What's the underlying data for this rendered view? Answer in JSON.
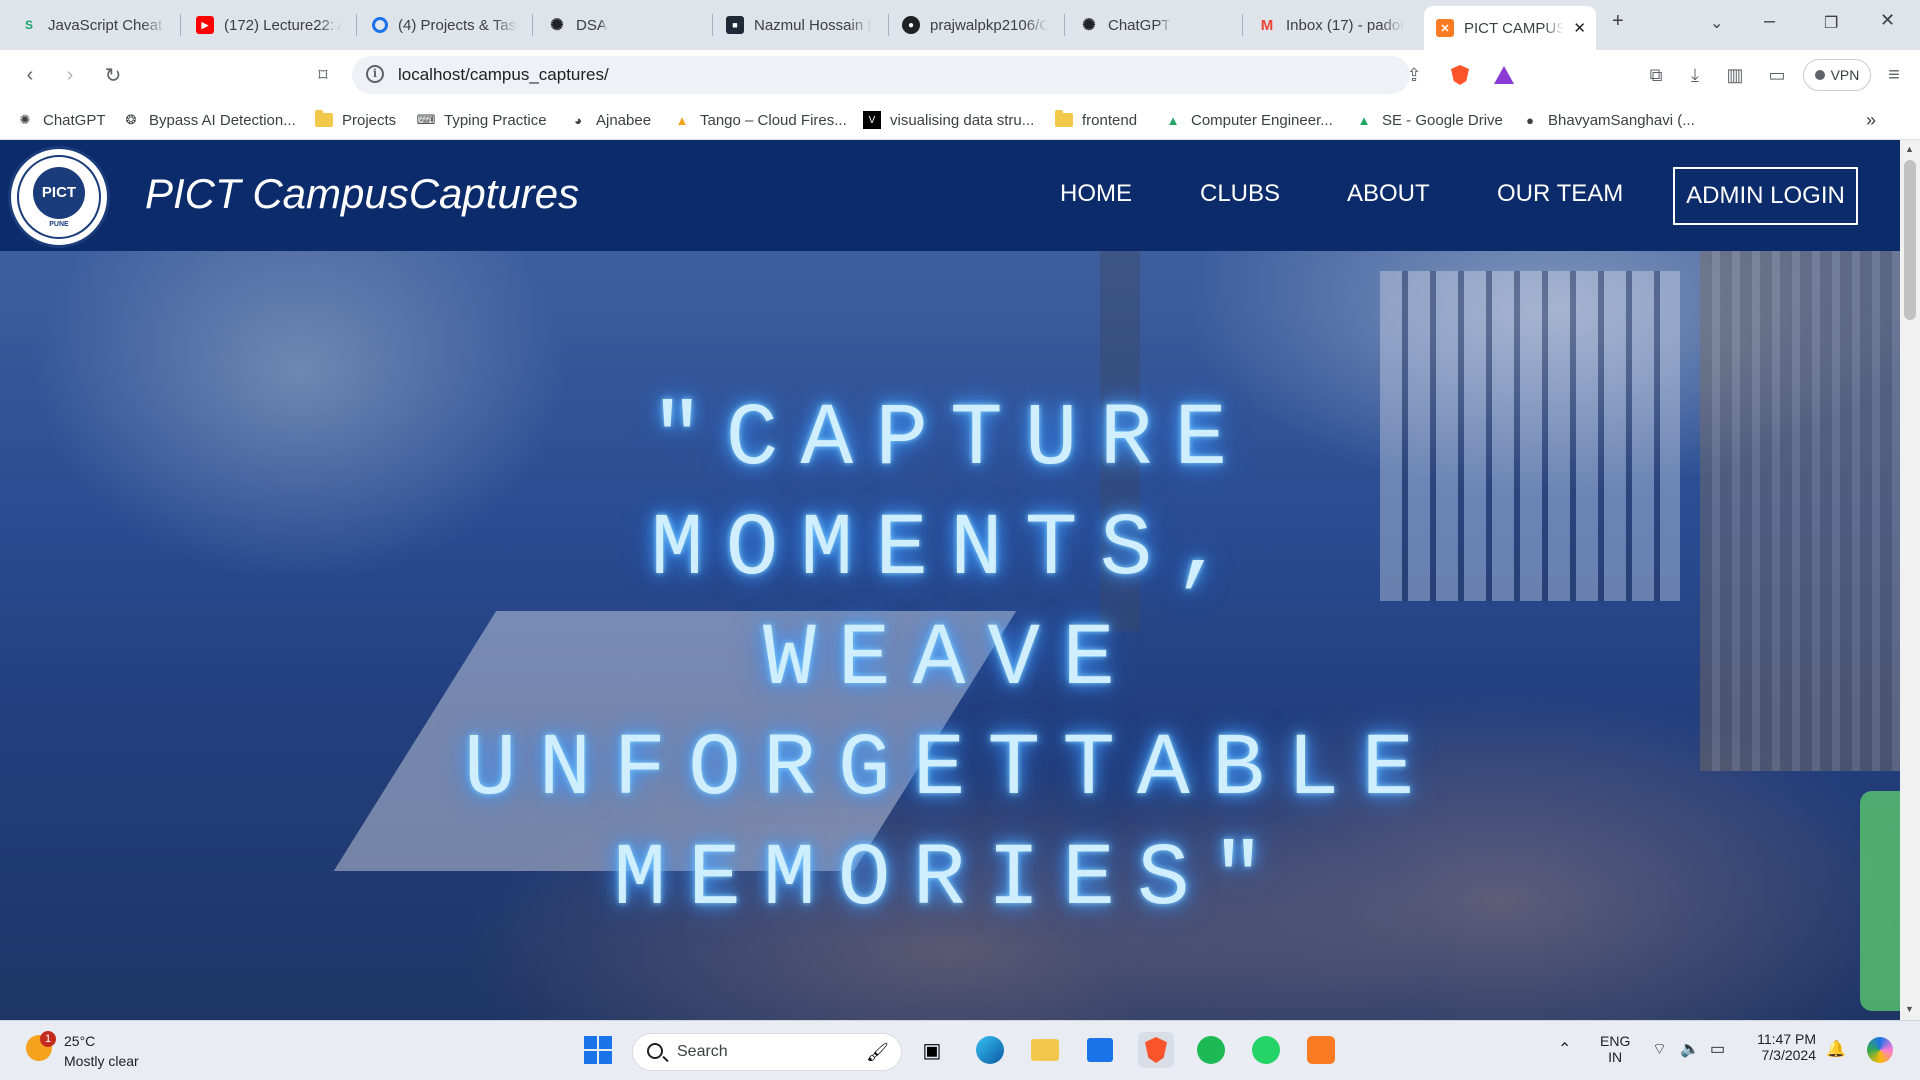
{
  "browser": {
    "tabs": [
      {
        "title": "JavaScript Cheat S",
        "icon": "javascript-cheatsheet-icon"
      },
      {
        "title": "(172) Lecture22: A",
        "icon": "youtube-icon"
      },
      {
        "title": "(4) Projects & Task",
        "icon": "projects-app-icon"
      },
      {
        "title": "DSA",
        "icon": "chatgpt-icon"
      },
      {
        "title": "Nazmul Hossain | F",
        "icon": "portfolio-icon"
      },
      {
        "title": "prajwalpkp2106/C",
        "icon": "github-icon"
      },
      {
        "title": "ChatGPT",
        "icon": "chatgpt-icon"
      },
      {
        "title": "Inbox (17) - padol",
        "icon": "gmail-icon"
      },
      {
        "title": "PICT CAMPUS",
        "icon": "xampp-icon",
        "active": true
      }
    ],
    "new_tab": "+",
    "url": "localhost/campus_captures/",
    "vpn_label": "VPN",
    "bookmarks": [
      {
        "label": "ChatGPT",
        "icon": "chatgpt-icon"
      },
      {
        "label": "Bypass AI Detection...",
        "icon": "bypass-icon"
      },
      {
        "label": "Projects",
        "icon": "folder-icon"
      },
      {
        "label": "Typing Practice",
        "icon": "typing-icon"
      },
      {
        "label": "Ajnabee",
        "icon": "ajnabee-icon"
      },
      {
        "label": "Tango – Cloud Fires...",
        "icon": "tango-icon"
      },
      {
        "label": "visualising data stru...",
        "icon": "visualgo-icon"
      },
      {
        "label": "frontend",
        "icon": "folder-icon"
      },
      {
        "label": "Computer Engineer...",
        "icon": "google-drive-icon"
      },
      {
        "label": "SE - Google Drive",
        "icon": "google-drive-icon"
      },
      {
        "label": "BhavyamSanghavi (...",
        "icon": "github-icon"
      }
    ],
    "more_bookmarks": "»"
  },
  "site": {
    "logo_text": "PICT",
    "logo_sub": "PUNE",
    "brand": "PICT CampusCaptures",
    "nav": [
      "HOME",
      "CLUBS",
      "ABOUT",
      "OUR TEAM"
    ],
    "admin_login": "ADMIN LOGIN",
    "hero_lines": [
      "\"CAPTURE",
      "MOMENTS,",
      "WEAVE",
      "UNFORGETTABLE",
      "MEMORIES\""
    ]
  },
  "taskbar": {
    "weather_badge": "1",
    "temperature": "25°C",
    "condition": "Mostly clear",
    "search_label": "Search",
    "lang_top": "ENG",
    "lang_bottom": "IN",
    "time": "11:47 PM",
    "date": "7/3/2024"
  },
  "colors": {
    "navbar": "#0b2b6b",
    "hero_text": "#cfeeff",
    "hero_glow": "#4aa8ff"
  }
}
